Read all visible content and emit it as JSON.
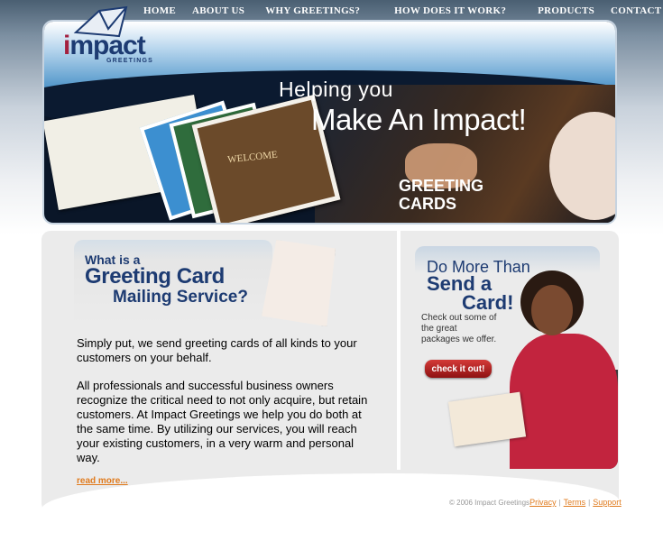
{
  "nav": {
    "items": [
      "HOME",
      "ABOUT US",
      "WHY GREETINGS?",
      "HOW DOES IT WORK?",
      "PRODUCTS",
      "CONTACT US"
    ]
  },
  "logo": {
    "word_first": "i",
    "word_rest": "mpact",
    "sub": "GREETINGS"
  },
  "banner": {
    "line1": "Helping you",
    "line2": "Make An Impact!",
    "caption_line1": "GREETING",
    "caption_line2": "CARDS",
    "mat_text": "WELCOME"
  },
  "main": {
    "heading_line1": "What is a",
    "heading_line2": "Greeting Card",
    "heading_line3": "Mailing Service?",
    "para1": "Simply put, we send greeting cards of all kinds to your customers on your behalf.",
    "para2": "All professionals and successful business owners recognize the critical need to not only acquire, but retain customers. At Impact Greetings we help you do both at the same time. By utilizing our services, you will reach your existing customers, in a very warm and personal way.",
    "read_more": "read more..."
  },
  "sidebar": {
    "heading_line1": "Do More Than",
    "heading_line2": "Send a",
    "heading_line3": "Card!",
    "text": "Check out some of the great packages we offer.",
    "button": "check it out!"
  },
  "footer": {
    "copyright": "© 2006 Impact Greetings",
    "links": [
      "Privacy",
      "Terms",
      "Support"
    ]
  },
  "colors": {
    "brand_navy": "#1d3b72",
    "brand_red": "#a3203f",
    "link_orange": "#e07b1e",
    "button_red": "#b02020"
  }
}
